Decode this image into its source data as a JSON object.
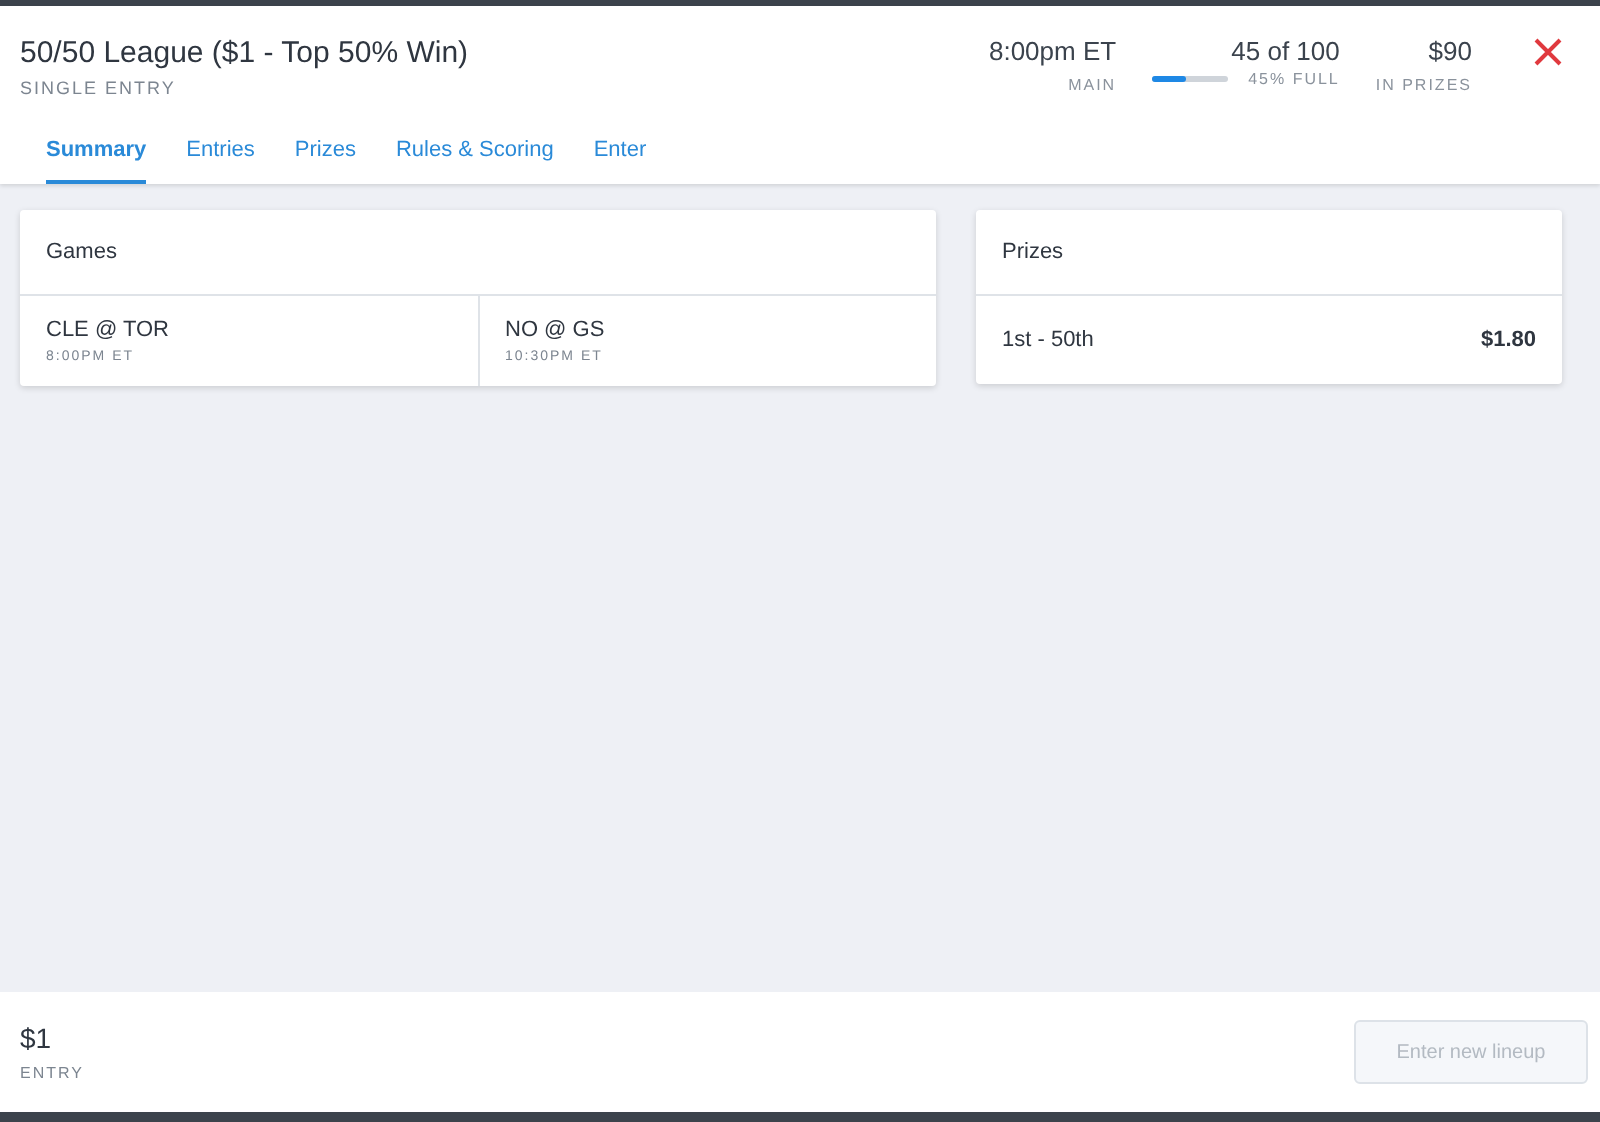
{
  "header": {
    "title": "50/50 League ($1 - Top 50% Win)",
    "subtitle": "SINGLE ENTRY",
    "stats": [
      {
        "kind": "text",
        "value": "8:00pm ET",
        "label": "MAIN"
      },
      {
        "kind": "progress",
        "value": "45 of 100",
        "label": "45% FULL",
        "level": 0.45
      },
      {
        "kind": "text",
        "value": "$90",
        "label": "IN PRIZES"
      }
    ]
  },
  "tabs": [
    {
      "label": "Summary",
      "selected": true
    },
    {
      "label": "Entries",
      "selected": false
    },
    {
      "label": "Prizes",
      "selected": false
    },
    {
      "label": "Rules & Scoring",
      "selected": false
    },
    {
      "label": "Enter",
      "selected": false
    }
  ],
  "games": {
    "title": "Games",
    "items": [
      {
        "matchup": "CLE @ TOR",
        "time": "8:00PM ET"
      },
      {
        "matchup": "NO @ GS",
        "time": "10:30PM ET"
      }
    ]
  },
  "prizes": {
    "title": "Prizes",
    "rows": [
      {
        "place": "1st - 50th",
        "amount": "$1.80"
      }
    ]
  },
  "footer": {
    "fee": "$1",
    "fee_label": "ENTRY",
    "button": {
      "label": "Enter new lineup",
      "disabled": true
    }
  }
}
